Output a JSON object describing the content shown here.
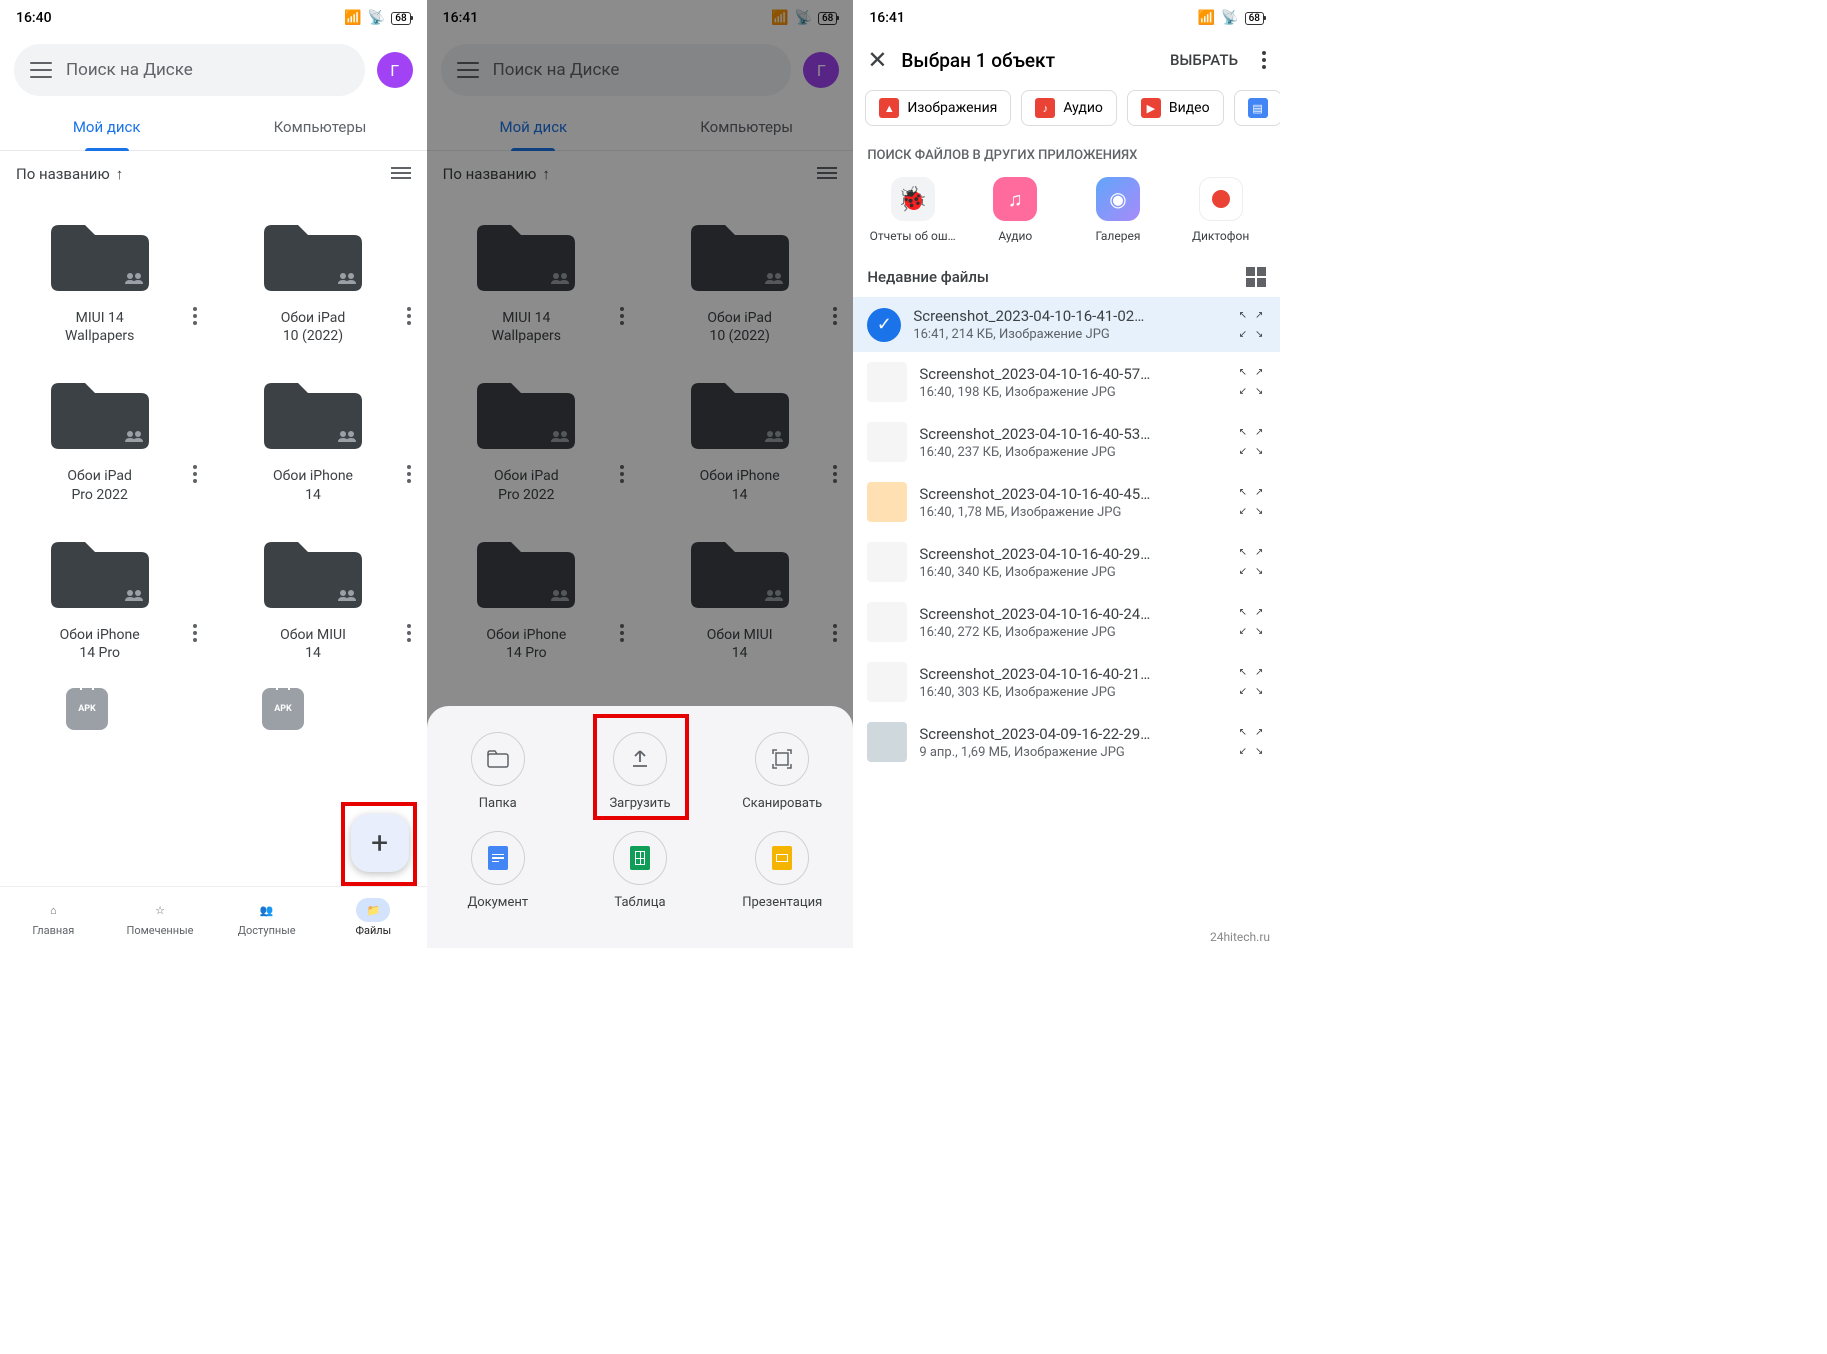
{
  "status": {
    "time1": "16:40",
    "time2": "16:41",
    "time3": "16:41",
    "battery": "68"
  },
  "search": {
    "placeholder": "Поиск на Диске",
    "avatar_letter": "Г"
  },
  "tabs": {
    "my_drive": "Мой диск",
    "computers": "Компьютеры"
  },
  "sort": {
    "label": "По названию",
    "arrow": "↑"
  },
  "folders": [
    {
      "name": "MIUI 14\nWallpapers"
    },
    {
      "name": "Обои iPad\n10 (2022)"
    },
    {
      "name": "Обои iPad\nPro 2022"
    },
    {
      "name": "Обои iPhone\n14"
    },
    {
      "name": "Обои iPhone\n14 Pro"
    },
    {
      "name": "Обои MIUI\n14"
    }
  ],
  "nav": {
    "home": "Главная",
    "starred": "Помеченные",
    "shared": "Доступные",
    "files": "Файлы"
  },
  "sheet": {
    "folder": "Папка",
    "upload": "Загрузить",
    "scan": "Сканировать",
    "doc": "Документ",
    "sheet": "Таблица",
    "pres": "Презентация"
  },
  "picker": {
    "title": "Выбран 1 объект",
    "select_btn": "ВЫБРАТЬ",
    "chip_images": "Изображения",
    "chip_audio": "Аудио",
    "chip_video": "Видео",
    "search_apps": "ПОИСК ФАЙЛОВ В ДРУГИХ ПРИЛОЖЕНИЯХ",
    "apps": {
      "bugs": "Отчеты об ош…",
      "audio": "Аудио",
      "gallery": "Галерея",
      "recorder": "Диктофон"
    },
    "recent": "Недавние файлы",
    "files": [
      {
        "name": "Screenshot_2023-04-10-16-41-02…",
        "meta": "16:41, 214 КБ, Изображение JPG",
        "selected": true
      },
      {
        "name": "Screenshot_2023-04-10-16-40-57…",
        "meta": "16:40, 198 КБ, Изображение JPG"
      },
      {
        "name": "Screenshot_2023-04-10-16-40-53…",
        "meta": "16:40, 237 КБ, Изображение JPG"
      },
      {
        "name": "Screenshot_2023-04-10-16-40-45…",
        "meta": "16:40, 1,78 МБ, Изображение JPG"
      },
      {
        "name": "Screenshot_2023-04-10-16-40-29…",
        "meta": "16:40, 340 КБ, Изображение JPG"
      },
      {
        "name": "Screenshot_2023-04-10-16-40-24…",
        "meta": "16:40, 272 КБ, Изображение JPG"
      },
      {
        "name": "Screenshot_2023-04-10-16-40-21…",
        "meta": "16:40, 303 КБ, Изображение JPG"
      },
      {
        "name": "Screenshot_2023-04-09-16-22-29…",
        "meta": "9 апр., 1,69 МБ, Изображение JPG"
      }
    ]
  },
  "watermark": "24hitech.ru"
}
